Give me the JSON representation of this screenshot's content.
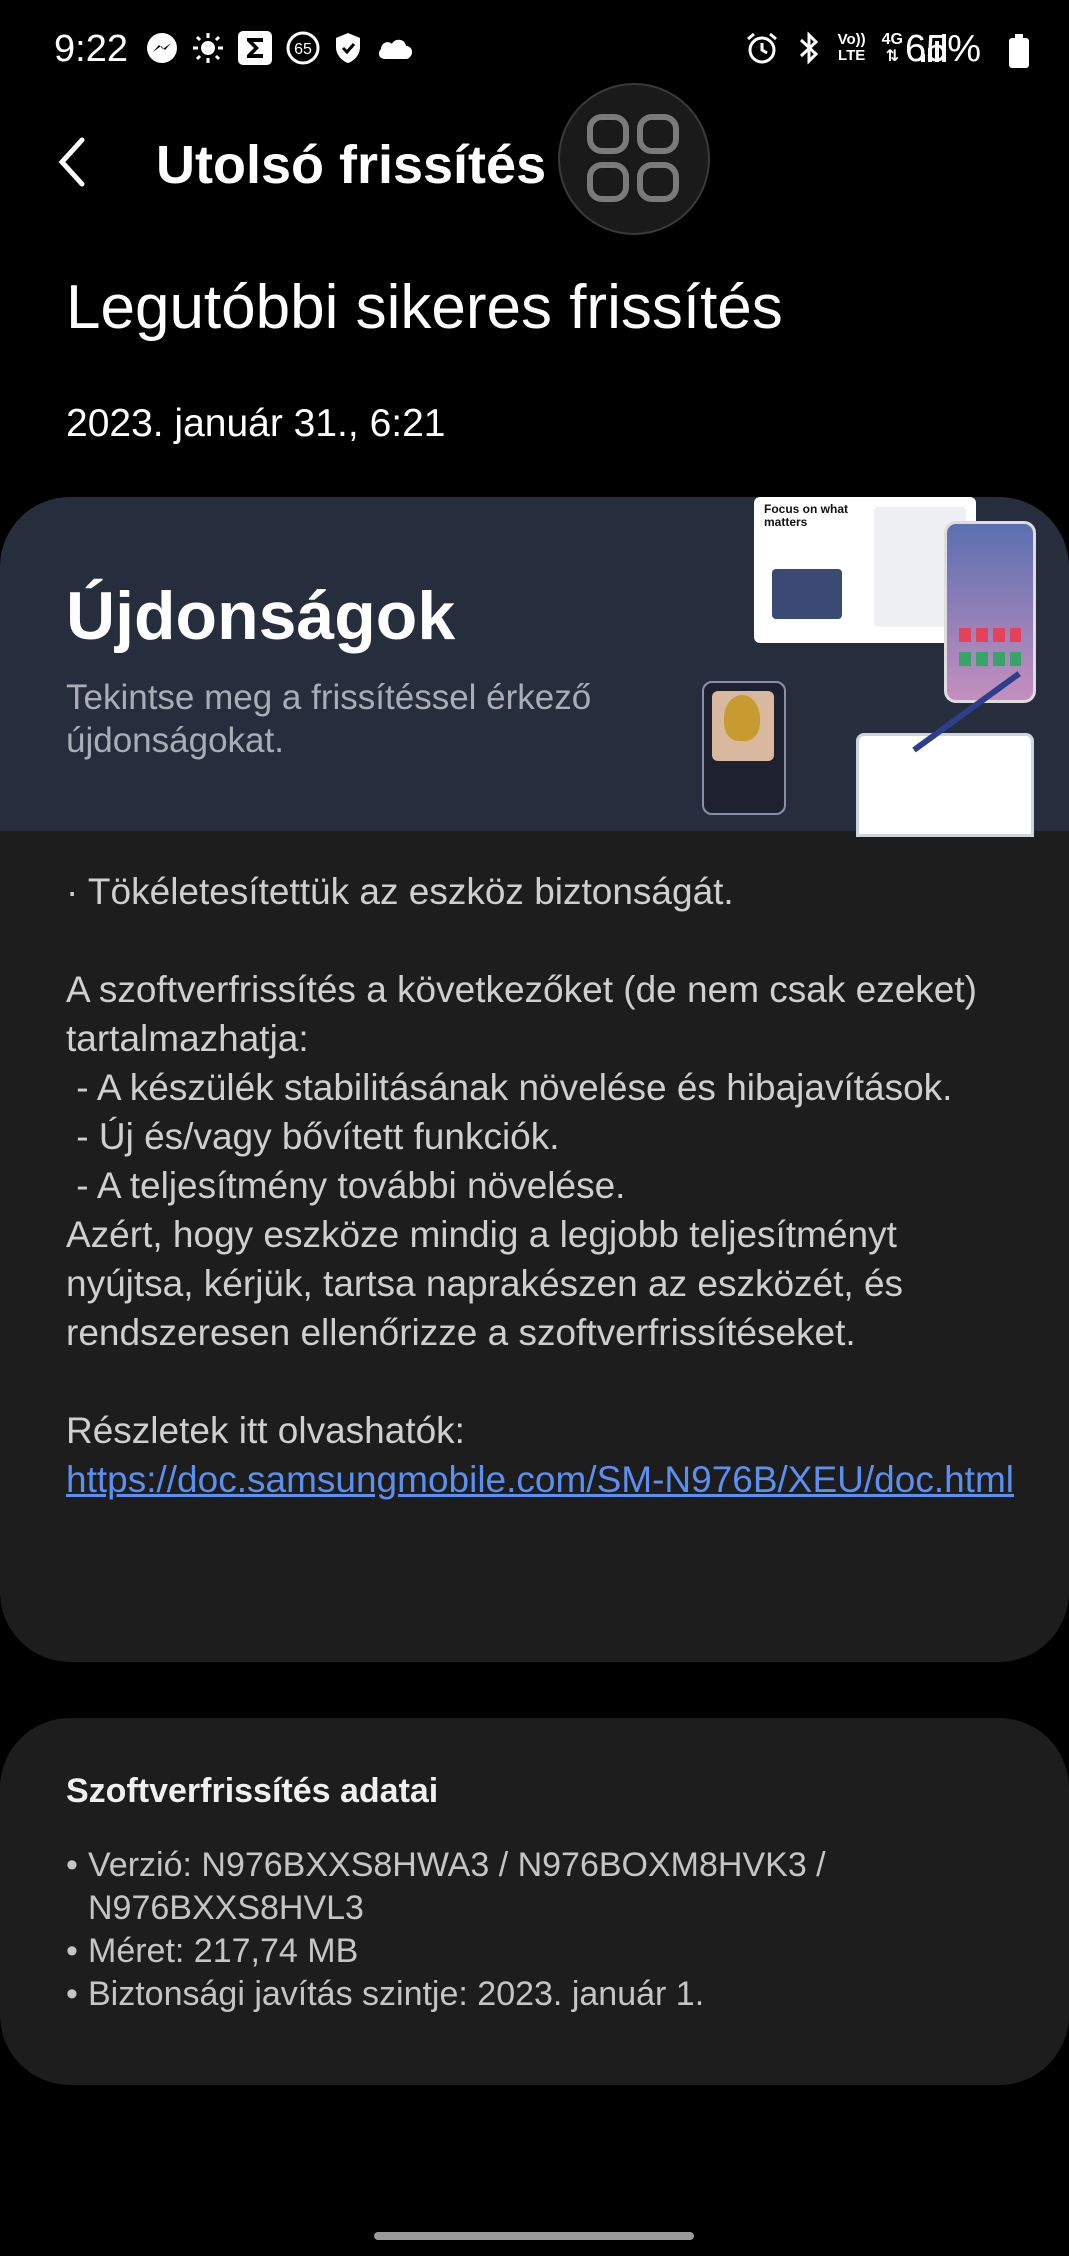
{
  "status_bar": {
    "time": "9:22",
    "battery": "65%",
    "left_icons": [
      "messenger-icon",
      "weather-sun-icon",
      "sigma-app-icon",
      "badge-65-icon",
      "shield-icon",
      "cloud-icon"
    ],
    "right_icons": [
      "alarm-icon",
      "bluetooth-icon",
      "volte-icon",
      "4g-icon",
      "signal-icon",
      "battery-icon"
    ],
    "badge_number": "65",
    "volte_top": "Vo))",
    "volte_bottom": "LTE",
    "network": "4G"
  },
  "header": {
    "title": "Utolsó frissítés"
  },
  "last_update": {
    "headline": "Legutóbbi sikeres frissítés",
    "date": "2023. január 31., 6:21"
  },
  "whats_new": {
    "title": "Újdonságok",
    "subtitle": "Tekintse meg a frissítéssel érkező újdonságokat.",
    "body": "· Tökéletesítettük az eszköz biztonságát.\n\nA szoftverfrissítés a következőket (de nem csak ezeket) tartalmazhatja:\n - A készülék stabilitásának növelése és hibajavítások.\n - Új és/vagy bővített funkciók.\n - A teljesítmény további növelése.\nAzért, hogy eszköze mindig a legjobb teljesítményt nyújtsa, kérjük, tartsa naprakészen az eszközét, és rendszeresen ellenőrizze a szoftverfrissítéseket.\n\nRészletek itt olvashatók:",
    "link": "https://doc.samsungmobile.com/SM-N976B/XEU/doc.html",
    "phone_screen_text": "Focus on what matters"
  },
  "details": {
    "title": "Szoftverfrissítés adatai",
    "items": [
      "Verzió: N976BXXS8HWA3 / N976BOXM8HVK3 / N976BXXS8HVL3",
      "Méret: 217,74 MB",
      "Biztonsági javítás szintje: 2023. január 1."
    ],
    "bullet": "•"
  },
  "colors": {
    "background": "#000000",
    "card": "#1d1d1d",
    "banner": "#262d3c",
    "link": "#5b8ff0"
  }
}
